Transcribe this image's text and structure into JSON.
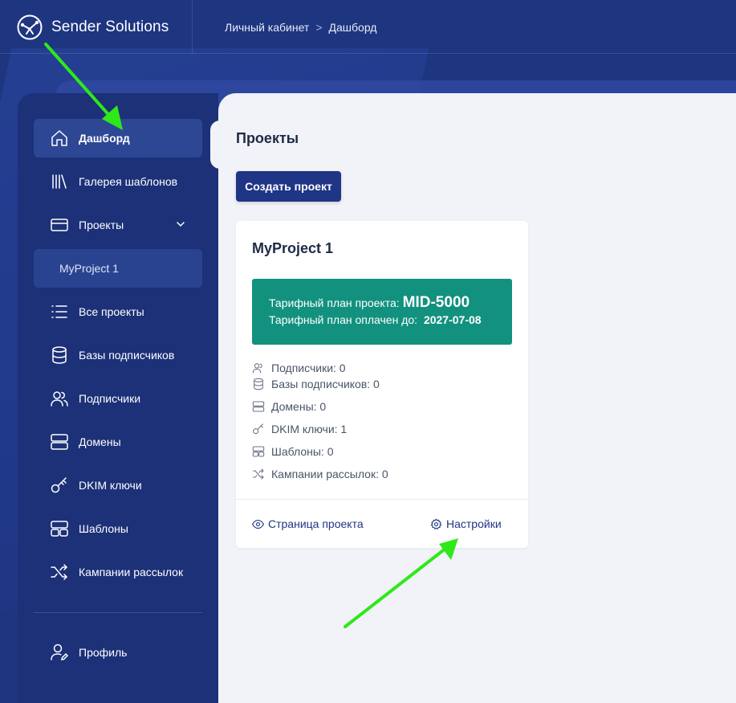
{
  "app": {
    "brand_name": "Sender Solutions"
  },
  "breadcrumb": {
    "items": [
      "Личный кабинет",
      "Дашборд"
    ],
    "separator": ">"
  },
  "sidebar": {
    "items": [
      {
        "label": "Дашборд",
        "icon": "home-icon",
        "active": true
      },
      {
        "label": "Галерея шаблонов",
        "icon": "library-icon"
      },
      {
        "label": "Проекты",
        "icon": "card-icon",
        "expandable": true
      },
      {
        "label": "MyProject 1",
        "icon": "",
        "sub": true
      },
      {
        "label": "Все проекты",
        "icon": "list-icon"
      },
      {
        "label": "Базы подписчиков",
        "icon": "database-icon"
      },
      {
        "label": "Подписчики",
        "icon": "users-icon"
      },
      {
        "label": "Домены",
        "icon": "server-icon"
      },
      {
        "label": "DKIM ключи",
        "icon": "key-icon"
      },
      {
        "label": "Шаблоны",
        "icon": "layout-icon"
      },
      {
        "label": "Кампании рассылок",
        "icon": "shuffle-icon"
      }
    ],
    "profile_label": "Профиль"
  },
  "main": {
    "title": "Проекты",
    "create_button": "Создать проект",
    "project": {
      "name": "MyProject 1",
      "plan_label": "Тарифный план проекта:",
      "plan_code": "MID-5000",
      "paid_label": "Тарифный план оплачен до:",
      "paid_until": "2027-07-08",
      "stats": [
        {
          "label": "Подписчики: 0",
          "icon": "users-icon"
        },
        {
          "label": "Базы подписчиков: 0",
          "icon": "database-icon"
        },
        {
          "label": "Домены: 0",
          "icon": "server-icon"
        },
        {
          "label": "DKIM ключи: 1",
          "icon": "key-icon"
        },
        {
          "label": "Шаблоны: 0",
          "icon": "layout-icon"
        },
        {
          "label": "Кампании рассылок: 0",
          "icon": "shuffle-icon"
        }
      ],
      "link_page": "Страница проекта",
      "link_settings": "Настройки"
    }
  },
  "colors": {
    "background": "#1e3580",
    "sidebar": "#1c3178",
    "accent": "#1f3585",
    "plan_box": "#13917f",
    "arrow": "#2fe81a"
  }
}
